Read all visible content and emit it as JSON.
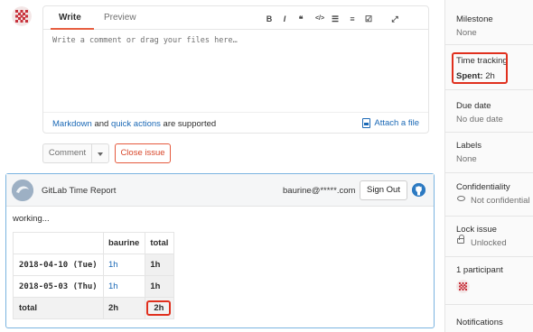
{
  "composer": {
    "tab_write": "Write",
    "tab_preview": "Preview",
    "toolbar": [
      {
        "name": "bold-icon",
        "glyph": "B"
      },
      {
        "name": "italic-icon",
        "glyph": "I"
      },
      {
        "name": "quote-icon",
        "glyph": "❝"
      },
      {
        "name": "code-icon",
        "glyph": "</>"
      },
      {
        "name": "bullet-list-icon",
        "glyph": "☰"
      },
      {
        "name": "numbered-list-icon",
        "glyph": "≡"
      },
      {
        "name": "task-list-icon",
        "glyph": "☑"
      },
      {
        "name": "fullscreen-icon",
        "glyph": "⤢"
      }
    ],
    "placeholder": "Write a comment or drag your files here…",
    "markdown_link": "Markdown",
    "and_text": " and ",
    "quick_actions_link": "quick actions",
    "supported_text": " are supported",
    "attach_label": "Attach a file"
  },
  "actions": {
    "comment_label": "Comment",
    "close_issue_label": "Close issue"
  },
  "extension": {
    "title": "GitLab Time Report",
    "email": "baurine@*****.com",
    "sign_out_label": "Sign Out",
    "status": "working...",
    "table": {
      "headers": [
        "",
        "baurine",
        "total"
      ],
      "rows": [
        {
          "date": "2018-04-10 (Tue)",
          "user": "1h",
          "total": "1h"
        },
        {
          "date": "2018-05-03 (Thu)",
          "user": "1h",
          "total": "1h"
        }
      ],
      "total_row": {
        "label": "total",
        "user": "2h",
        "total": "2h"
      }
    }
  },
  "sidebar": {
    "milestone_title": "Milestone",
    "milestone_value": "None",
    "time_tracking_title": "Time tracking",
    "time_tracking_spent_label": "Spent:",
    "time_tracking_spent_value": "2h",
    "due_date_title": "Due date",
    "due_date_value": "No due date",
    "labels_title": "Labels",
    "labels_value": "None",
    "confidentiality_title": "Confidentiality",
    "confidentiality_value": "Not confidential",
    "lock_title": "Lock issue",
    "lock_value": "Unlocked",
    "participants_title": "1 participant",
    "notifications_title": "Notifications"
  },
  "colors": {
    "accent_orange": "#e75e40",
    "link_blue": "#1b69b6",
    "highlight_red": "#e0301e"
  }
}
